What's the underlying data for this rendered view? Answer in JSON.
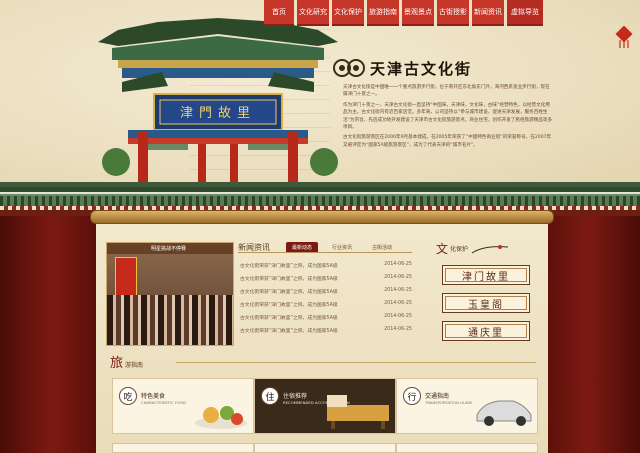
{
  "nav": {
    "items": [
      "首页",
      "文化研究",
      "文化保护",
      "旅游指南",
      "景观景点",
      "古街授影",
      "新闻资讯",
      "虚拟导览"
    ]
  },
  "brand": {
    "title": "天津古文化街"
  },
  "gate": {
    "plaque_text": "津門故里"
  },
  "intro": {
    "paragraphs": [
      "天津古文化街是中国唯一一个重点旅游步行街，位于南开区东北角东门外，海河西系宽业步行街，现在属津门十景之一。",
      "作为津门十景之一，天津古文化街一直坚持“中国味，天津味，文化味，古味”经营特色，以经营文化用品为主。古文化街内有近百家店堂。多年来，公司坚持以“参与城市建设，促进天津发展，服务百姓生活”为宗旨，先后成功地开发建设了天津市古文化街旅游景点，商业住宅，创作开发了民俗旅游精品等多项目。",
      "古文化街旅游景区在2006年9月基本建成，在2005年荣获了“中国特色商业街”的荣誉称号，在2007年又被评定为“国家5A级旅游景区”，成为了代表天津的“城市名片”。"
    ]
  },
  "news": {
    "photo_caption": "明星挑战不停赛",
    "title": "新闻资讯",
    "tabs": [
      "最新动态",
      "行业资讯",
      "古街活动"
    ],
    "rows": [
      {
        "text": "古文化街荣获“津门故里”之称，成为国家5A级",
        "date": "2014-06-25"
      },
      {
        "text": "古文化街荣获“津门故里”之称，成为国家5A级",
        "date": "2014-06-25"
      },
      {
        "text": "古文化街荣获“津门故里”之称，成为国家5A级",
        "date": "2014-06-25"
      },
      {
        "text": "古文化街荣获“津门故里”之称，成为国家5A级",
        "date": "2014-06-25"
      },
      {
        "text": "古文化街荣获“津门故里”之称，成为国家5A级",
        "date": "2014-06-25"
      },
      {
        "text": "古文化街荣获“津门故里”之称，成为国家5A级",
        "date": "2014-06-25"
      }
    ]
  },
  "culture": {
    "head_big": "文",
    "head_small": "化保护",
    "buttons": [
      "津门故里",
      "玉皇阁",
      "通庆里"
    ]
  },
  "guide": {
    "head_big": "旅",
    "head_small": "游指南",
    "cards": [
      {
        "glyph": "吃",
        "name": "特色美食",
        "en": "CHARACTERISTIC FOOD"
      },
      {
        "glyph": "住",
        "name": "住宿推荐",
        "en": "RECOMMENDED ACCOMMODATION"
      },
      {
        "glyph": "行",
        "name": "交通指南",
        "en": "TRANSPORTATION GUIDE"
      }
    ]
  },
  "colors": {
    "nav_red": "#c6372a",
    "curtain_red": "#5c0f0a",
    "paper": "#efe4c6",
    "roof_green": "#3d5a38"
  }
}
